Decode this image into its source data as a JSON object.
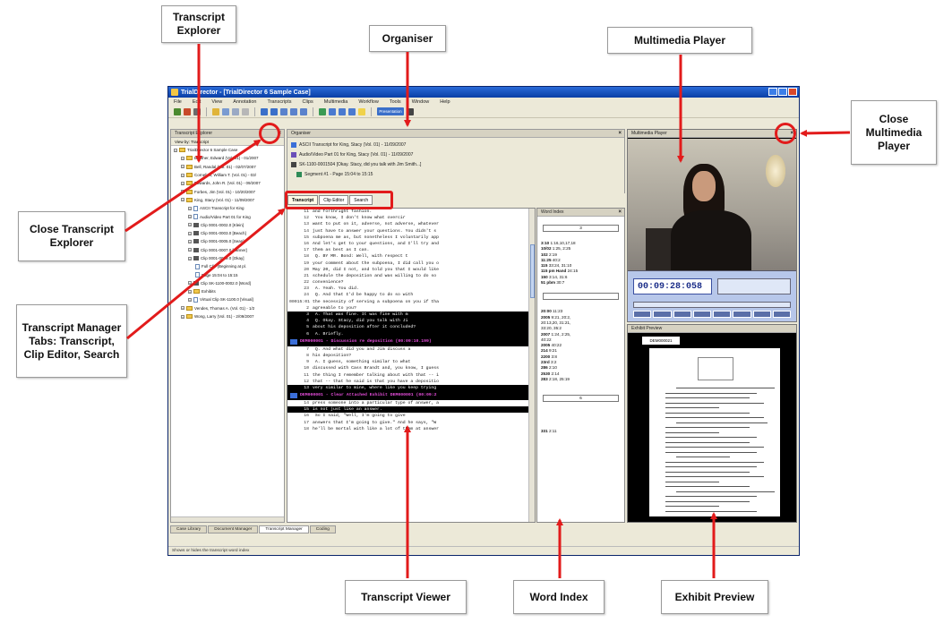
{
  "callouts": {
    "transcript_explorer": "Transcript Explorer",
    "organiser": "Organiser",
    "multimedia_player": "Multimedia Player",
    "close_multimedia_player": "Close Multimedia Player",
    "close_transcript_explorer": "Close Transcript Explorer",
    "transcript_manager_tabs": "Transcript Manager Tabs: Transcript, Clip Editor, Search",
    "transcript_viewer": "Transcript Viewer",
    "word_index": "Word Index",
    "exhibit_preview": "Exhibit Preview"
  },
  "window": {
    "title": "TrialDirector - [TrialDirector 6 Sample Case]",
    "menu": [
      "File",
      "Edit",
      "View",
      "Annotation",
      "Transcripts",
      "Clips",
      "Multimedia",
      "Workflow",
      "Tools",
      "Window",
      "Help"
    ],
    "presentation_button": "Presentation"
  },
  "explorer": {
    "title": "Transcript Explorer",
    "view_by": "View by: Transcript",
    "items": [
      {
        "label": "TrialDirector 6 Sample Case",
        "icon": "folder",
        "indent": 0
      },
      {
        "label": "Banther, Edward (Vol. 01) - 01/2007",
        "icon": "folder",
        "indent": 1
      },
      {
        "label": "Bell, Randal (Vol. 01) - 02/07/2007",
        "icon": "folder",
        "indent": 1
      },
      {
        "label": "Cornelius, William T. (Vol. 01) - 03/",
        "icon": "folder",
        "indent": 1
      },
      {
        "label": "Edwards, John R. (Vol. 01) - 09/2007",
        "icon": "folder",
        "indent": 1
      },
      {
        "label": "Forbes, Jim (Vol. 01) - 10/20/2007",
        "icon": "folder",
        "indent": 1
      },
      {
        "label": "King, Stacy (Vol. 01) - 11/09/2007",
        "icon": "folder",
        "indent": 1
      },
      {
        "label": "ASCII Transcript for King",
        "icon": "doc",
        "indent": 2
      },
      {
        "label": "Audio/Video Part 01 for King",
        "icon": "doc",
        "indent": 2
      },
      {
        "label": "Clip 0001-0002.0 [Klein]",
        "icon": "video",
        "indent": 2
      },
      {
        "label": "Clip 0001-0003.0 [Beach]",
        "icon": "video",
        "indent": 2
      },
      {
        "label": "Clip 0001-0005.0 [Sean]",
        "icon": "video",
        "indent": 2
      },
      {
        "label": "Clip 0001-0007.0 [Tanner]",
        "icon": "video",
        "indent": 2
      },
      {
        "label": "Clip 0001-0009.0 [Okay]",
        "icon": "video",
        "indent": 2
      },
      {
        "label": "Full Clip (Beginning at pl.",
        "icon": "doc",
        "indent": 3
      },
      {
        "label": "Page 15:04 to 15:15",
        "icon": "doc",
        "indent": 3
      },
      {
        "label": "Clip SK-1100-0002.0 [Word]",
        "icon": "video",
        "indent": 2
      },
      {
        "label": "Exhibits",
        "icon": "folder",
        "indent": 2
      },
      {
        "label": "Virtual Clip SK-1100.0 [Visual]",
        "icon": "doc",
        "indent": 2
      },
      {
        "label": "Vendes, Thomas A. (Vol. 01) - 1/2",
        "icon": "folder",
        "indent": 1
      },
      {
        "label": "Wong, Larry (Vol. 01) - 2/09/2007",
        "icon": "folder",
        "indent": 1
      }
    ]
  },
  "organiser": {
    "title": "Organiser",
    "rows": [
      "ASCII Transcript for King, Stacy (Vol. 01) - 11/09/2007",
      "Audio/Video Part 01 for King, Stacy (Vol. 01) - 11/09/2007",
      "SK-1100-0001504 [Okay. Stacy, did you talk with Jim Smith...]",
      "Segment #1 - Page 15:04 to 15:15"
    ]
  },
  "tabs": [
    "Transcript",
    "Clip Editor",
    "Search"
  ],
  "transcript": {
    "lines": [
      {
        "ln": "11",
        "text": "and forthright fashion.",
        "style": "normal"
      },
      {
        "ln": "12",
        "text": "          You know, I don't know what overcir",
        "style": "normal"
      },
      {
        "ln": "13",
        "text": "want to put on it, adverse, not adverse, whatever",
        "style": "normal"
      },
      {
        "ln": "14",
        "text": "just have to answer your questions. You didn't s",
        "style": "normal"
      },
      {
        "ln": "15",
        "text": "subpoena me as, but nonetheless I voluntarily app",
        "style": "normal"
      },
      {
        "ln": "16",
        "text": "And let's get to your questions, and I'll try and",
        "style": "normal"
      },
      {
        "ln": "17",
        "text": "them as best as I can.",
        "style": "normal"
      },
      {
        "ln": "18",
        "text": "          Q.  BY MR. Bond:  Well, with respect t",
        "style": "normal"
      },
      {
        "ln": "19",
        "text": "your comment about the subpoena, I did call you o",
        "style": "normal"
      },
      {
        "ln": "20",
        "text": "May 20, did I not, and told you that I would like",
        "style": "normal"
      },
      {
        "ln": "21",
        "text": "schedule the deposition and was willing to do so",
        "style": "normal"
      },
      {
        "ln": "22",
        "text": "convenience?",
        "style": "normal"
      },
      {
        "ln": "23",
        "text": "          A.  Yeah.  You did.",
        "style": "normal"
      },
      {
        "ln": "24",
        "text": "          Q.  And that I'd be happy to do so with",
        "style": "normal"
      },
      {
        "ln": "00015:01",
        "text": "the necessity of serving a subpoena on you if tha",
        "style": "normal"
      },
      {
        "ln": "2",
        "text": "agreeable to you?",
        "style": "normal"
      },
      {
        "ln": "3",
        "text": "          A.  That was fine.  It was fine with m",
        "style": "hl"
      },
      {
        "ln": "4",
        "text": "          Q.  Okay.  Stacy, did you talk with Ji",
        "style": "hl"
      },
      {
        "ln": "5",
        "text": "about his deposition after it concluded?",
        "style": "hl"
      },
      {
        "ln": "6",
        "text": "          A.  Briefly.",
        "style": "hl"
      },
      {
        "ln": "",
        "text": "DEM000001 - Discussion re deposition (00:09:10.199)",
        "style": "seg"
      },
      {
        "ln": "7",
        "text": "          Q.  And what did you and Jim discuss a",
        "style": "normal"
      },
      {
        "ln": "8",
        "text": "his deposition?",
        "style": "normal"
      },
      {
        "ln": "9",
        "text": "          A.  I guess, something similar to what",
        "style": "normal"
      },
      {
        "ln": "10",
        "text": "discussed with Cass Brandt and, you know, I guess",
        "style": "normal"
      },
      {
        "ln": "11",
        "text": "the thing I remember talking about with that -- i",
        "style": "normal"
      },
      {
        "ln": "12",
        "text": "that -- that he said is that you have a depositio",
        "style": "normal"
      },
      {
        "ln": "13",
        "text": "very similar to mine, where like you keep trying",
        "style": "hl"
      },
      {
        "ln": "",
        "text": "DEM000001 - Clear Attached Exhibit DEM000001 (00:09:2",
        "style": "seg"
      },
      {
        "ln": "14",
        "text": "press someone into a particular type of answer, a",
        "style": "normal"
      },
      {
        "ln": "15",
        "text": "is not just like an answer.",
        "style": "hl"
      },
      {
        "ln": "16",
        "text": "          So I said, \"Well, I'm going to give",
        "style": "normal"
      },
      {
        "ln": "17",
        "text": "answers that I'm going to give.\"  And he says, \"W",
        "style": "normal"
      },
      {
        "ln": "18",
        "text": "he'll be mortal with like a lot of them at answer",
        "style": "normal"
      }
    ]
  },
  "word_index": {
    "title": "Word Index",
    "boxes": [
      "3",
      "",
      "6"
    ],
    "group1": [
      {
        "w": "3:10",
        "p": "1:16,10,17,18"
      },
      {
        "w": "10/02",
        "p": "1:25, 2:25"
      },
      {
        "w": "102",
        "p": "2:19"
      },
      {
        "w": "11:25",
        "p": "40:2"
      },
      {
        "w": "115",
        "p": "33:24, 31:10"
      },
      {
        "w": "115 pm Hand",
        "p": "24:15"
      },
      {
        "w": "150",
        "p": "3:14, 31:6"
      },
      {
        "w": "51 pbm",
        "p": "30:7"
      }
    ],
    "group2": [
      {
        "w": "20:00",
        "p": "11:23"
      },
      {
        "w": "2005",
        "p": "9:21, 20:2,"
      },
      {
        "w": "",
        "p": "20:13,20, 31:21,"
      },
      {
        "w": "",
        "p": "33:20, 35:2"
      },
      {
        "w": "2007",
        "p": "1:24, 2:25,"
      },
      {
        "w": "",
        "p": "40:22"
      },
      {
        "w": "2005",
        "p": "40:22"
      },
      {
        "w": "214",
        "p": "9:21"
      },
      {
        "w": "2200",
        "p": "3:8"
      },
      {
        "w": "23rd",
        "p": "3:2"
      },
      {
        "w": "286",
        "p": "2:10"
      },
      {
        "w": "2530",
        "p": "2:14"
      },
      {
        "w": "283",
        "p": "2:18, 25:19"
      }
    ],
    "group3": [
      {
        "w": "331",
        "p": "2:11"
      }
    ]
  },
  "multimedia": {
    "title": "Multimedia Player",
    "timecode": "00:09:28:058"
  },
  "exhibit": {
    "title": "Exhibit Preview",
    "label": "DEM000021"
  },
  "bottom_tabs": [
    "Case Library",
    "Document Manager",
    "Transcript Manager",
    "Coding"
  ],
  "status": "Shows or hides the transcript word index"
}
